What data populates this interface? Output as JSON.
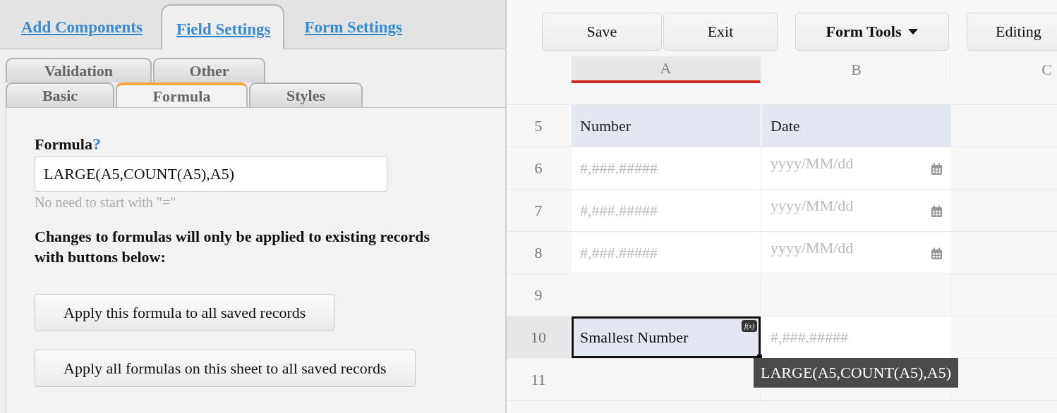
{
  "left_panel": {
    "tabs": [
      {
        "label": "Add Components",
        "selected": false
      },
      {
        "label": "Field Settings",
        "selected": true
      },
      {
        "label": "Form Settings",
        "selected": false
      }
    ],
    "sub_tab_rows": [
      {
        "tabs": [
          {
            "label": "Validation",
            "selected": false
          },
          {
            "label": "Other",
            "selected": false
          }
        ]
      },
      {
        "tabs": [
          {
            "label": "Basic",
            "selected": false
          },
          {
            "label": "Formula",
            "selected": true
          },
          {
            "label": "Styles",
            "selected": false
          }
        ]
      }
    ],
    "formula": {
      "label": "Formula",
      "help": "?",
      "value": "LARGE(A5,COUNT(A5),A5)",
      "hint": "No need to start with \"=\""
    },
    "note": "Changes to formulas will only be applied to existing records with buttons below:",
    "buttons": [
      "Apply this formula to all saved records",
      "Apply all formulas on this sheet to all saved records"
    ]
  },
  "toolbar": {
    "buttons": [
      {
        "label": "Save",
        "kind": "plain"
      },
      {
        "label": "Exit",
        "kind": "plain"
      },
      {
        "label": "Form Tools",
        "kind": "menu"
      },
      {
        "label": "Editing",
        "kind": "plain"
      }
    ]
  },
  "grid": {
    "columns": [
      {
        "label": "A",
        "selected": true
      },
      {
        "label": "B",
        "selected": false
      },
      {
        "label": "C",
        "selected": false
      }
    ],
    "rows": [
      {
        "label": "5",
        "selected": false,
        "cells": [
          {
            "kind": "header",
            "text": "Number"
          },
          {
            "kind": "header",
            "text": "Date"
          },
          {
            "kind": "blank"
          }
        ]
      },
      {
        "label": "6",
        "selected": false,
        "cells": [
          {
            "kind": "number",
            "text": "#,###.#####"
          },
          {
            "kind": "date",
            "text": "yyyy/MM/dd"
          },
          {
            "kind": "blank"
          }
        ]
      },
      {
        "label": "7",
        "selected": false,
        "cells": [
          {
            "kind": "number",
            "text": "#,###.#####"
          },
          {
            "kind": "date",
            "text": "yyyy/MM/dd"
          },
          {
            "kind": "blank"
          }
        ]
      },
      {
        "label": "8",
        "selected": false,
        "cells": [
          {
            "kind": "number",
            "text": "#,###.#####"
          },
          {
            "kind": "date",
            "text": "yyyy/MM/dd"
          },
          {
            "kind": "blank"
          }
        ]
      },
      {
        "label": "9",
        "selected": false,
        "cells": [
          {
            "kind": "blank"
          },
          {
            "kind": "blank"
          },
          {
            "kind": "blank"
          }
        ]
      },
      {
        "label": "10",
        "selected": true,
        "cells": [
          {
            "kind": "formula",
            "text": "Smallest Number",
            "badge": "f(x)"
          },
          {
            "kind": "number",
            "text": "#,###.#####"
          },
          {
            "kind": "blank"
          }
        ]
      },
      {
        "label": "11",
        "selected": false,
        "cells": [
          {
            "kind": "blank"
          },
          {
            "kind": "blank"
          },
          {
            "kind": "blank"
          }
        ]
      }
    ],
    "tooltip": "LARGE(A5,COUNT(A5),A5)"
  }
}
